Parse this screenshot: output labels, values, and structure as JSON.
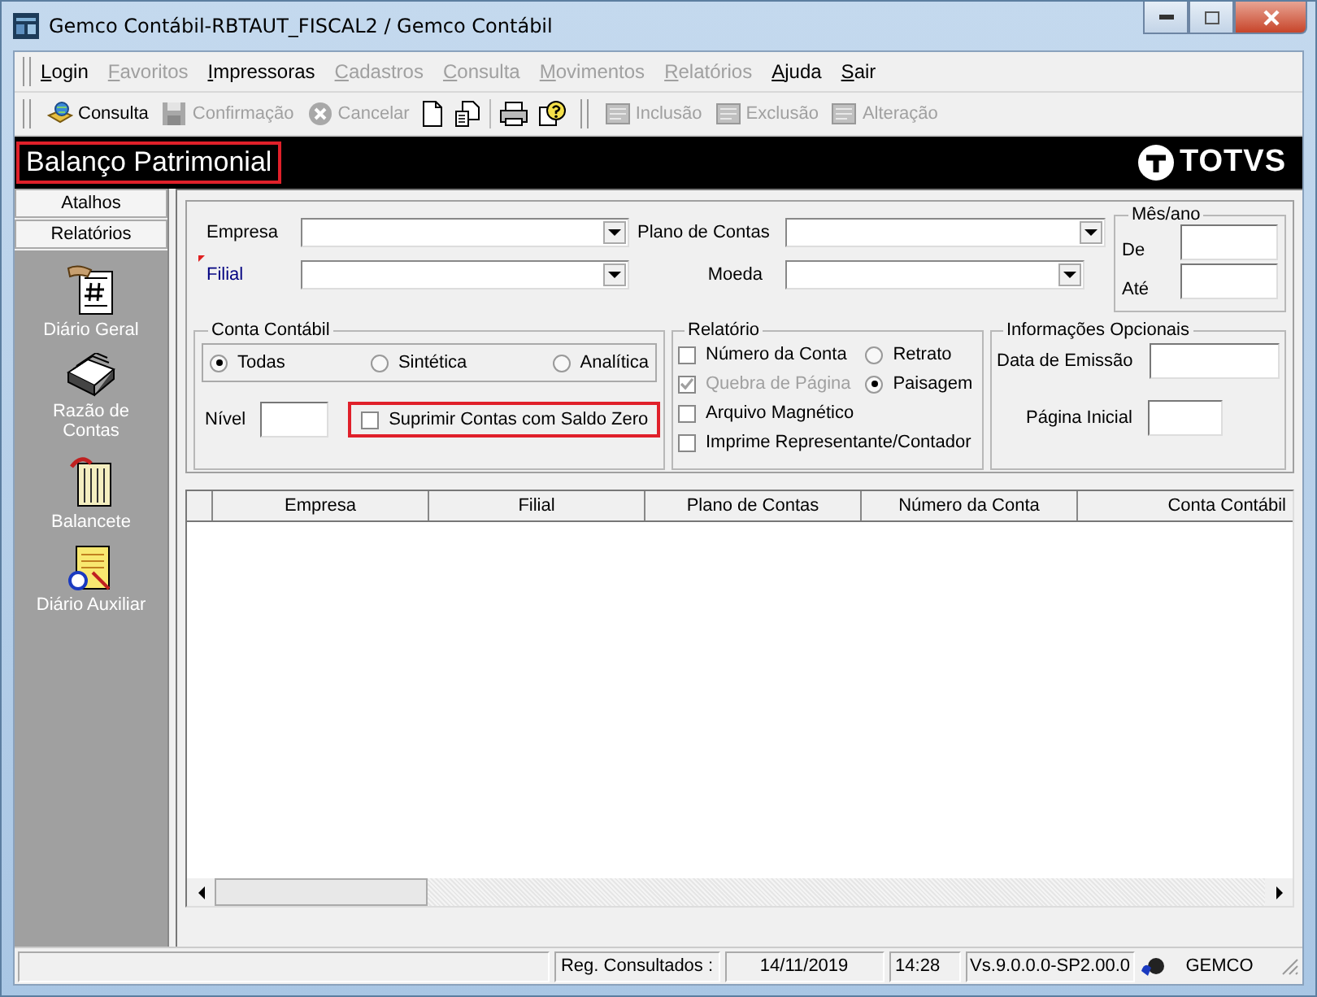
{
  "window": {
    "title": "Gemco Contábil-RBTAUT_FISCAL2 / Gemco Contábil"
  },
  "menu": [
    {
      "label": "Login",
      "disabled": false
    },
    {
      "label": "Favoritos",
      "disabled": true
    },
    {
      "label": "Impressoras",
      "disabled": false
    },
    {
      "label": "Cadastros",
      "disabled": true
    },
    {
      "label": "Consulta",
      "disabled": true
    },
    {
      "label": "Movimentos",
      "disabled": true
    },
    {
      "label": "Relatórios",
      "disabled": true
    },
    {
      "label": "Ajuda",
      "disabled": false
    },
    {
      "label": "Sair",
      "disabled": false
    }
  ],
  "toolbar": {
    "actions": [
      {
        "label": "Consulta",
        "disabled": false
      },
      {
        "label": "Confirmação",
        "disabled": true
      },
      {
        "label": "Cancelar",
        "disabled": true
      }
    ],
    "record_actions": [
      {
        "label": "Inclusão",
        "disabled": true
      },
      {
        "label": "Exclusão",
        "disabled": true
      },
      {
        "label": "Alteração",
        "disabled": true
      }
    ]
  },
  "header": {
    "title": "Balanço Patrimonial",
    "highlighted": true,
    "logo": "TOTVS"
  },
  "sidebar": {
    "sections": [
      {
        "label": "Atalhos"
      },
      {
        "label": "Relatórios"
      }
    ],
    "items": [
      {
        "label": "Diário Geral"
      },
      {
        "label": "Razão de Contas"
      },
      {
        "label": "Balancete"
      },
      {
        "label": "Diário Auxiliar"
      }
    ]
  },
  "form": {
    "empresa": {
      "label": "Empresa",
      "required": false
    },
    "filial": {
      "label": "Filial",
      "required": true
    },
    "plano_de_contas": {
      "label": "Plano de Contas"
    },
    "moeda": {
      "label": "Moeda"
    },
    "mes_ano": {
      "title": "Mês/ano",
      "from_label": "De",
      "to_label": "Até"
    },
    "conta_contabil": {
      "title": "Conta Contábil",
      "options": [
        {
          "label": "Todas",
          "selected": true
        },
        {
          "label": "Sintética",
          "selected": false
        },
        {
          "label": "Analítica",
          "selected": false
        }
      ],
      "nivel_label": "Nível",
      "suppress_zero": {
        "label": "Suprimir Contas com Saldo Zero",
        "checked": false,
        "highlighted": true
      }
    },
    "relatorio": {
      "title": "Relatório",
      "checkboxes": [
        {
          "label": "Número da Conta",
          "checked": false,
          "disabled": false
        },
        {
          "label": "Quebra de Página",
          "checked": true,
          "disabled": true
        },
        {
          "label": "Arquivo Magnético",
          "checked": false,
          "disabled": false
        },
        {
          "label": "Imprime Representante/Contador",
          "checked": false,
          "disabled": false
        }
      ],
      "orientation": [
        {
          "label": "Retrato",
          "selected": false
        },
        {
          "label": "Paisagem",
          "selected": true
        }
      ]
    },
    "informacoes_opcionais": {
      "title": "Informações Opcionais",
      "fields": [
        {
          "label": "Data de Emissão"
        },
        {
          "label": "Página Inicial"
        }
      ]
    }
  },
  "table": {
    "columns": [
      "Empresa",
      "Filial",
      "Plano de Contas",
      "Número da Conta",
      "Conta Contábil"
    ]
  },
  "status_bar": {
    "reg_label": "Reg. Consultados :",
    "date": "14/11/2019",
    "time": "14:28",
    "version": "Vs.9.0.0.0-SP2.00.0",
    "user": "GEMCO"
  }
}
